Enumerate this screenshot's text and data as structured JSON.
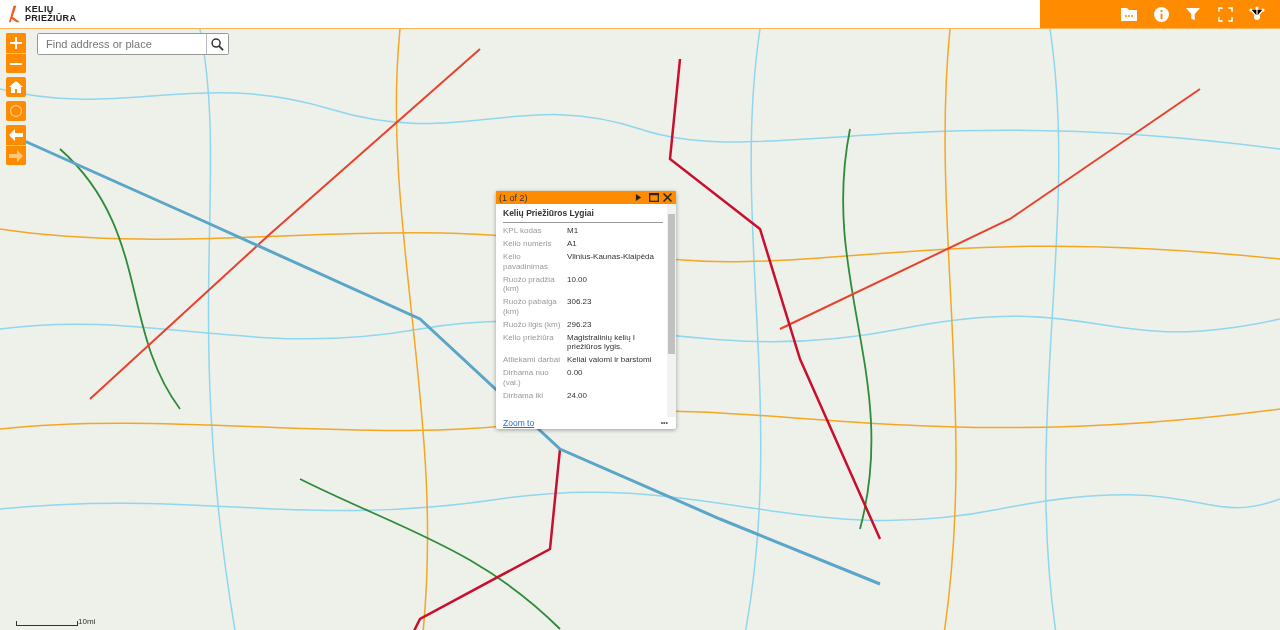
{
  "header": {
    "logo_line_1": "KELIŲ",
    "logo_line_2": "PRIEŽIŪRA"
  },
  "search": {
    "placeholder": "Find address or place"
  },
  "popup": {
    "counter": "(1 of 2)",
    "title": "Kelių Priežiūros Lygiai",
    "rows": [
      {
        "label": "KPL kodas",
        "value": "M1"
      },
      {
        "label": "Kelio numeris",
        "value": "A1"
      },
      {
        "label": "Kelio pavadinimas",
        "value": "Vilnius-Kaunas-Klaipėda"
      },
      {
        "label": "Ruožo pradžia (km)",
        "value": "10.00"
      },
      {
        "label": "Ruožo pabaiga (km)",
        "value": "306.23"
      },
      {
        "label": "Ruožo ilgis (km)",
        "value": "296.23"
      },
      {
        "label": "Kelio priežiūra",
        "value": "Magistralinių kelių I priežiūros lygis."
      },
      {
        "label": "Atliekami darbai",
        "value": "Keliai valomi ir barstomi"
      },
      {
        "label": "Dirbama nuo (val.)",
        "value": "0.00"
      },
      {
        "label": "Dirbama iki",
        "value": "24.00"
      }
    ],
    "link": "Zoom to",
    "more": "•••"
  },
  "scale": {
    "label": "10mi"
  }
}
